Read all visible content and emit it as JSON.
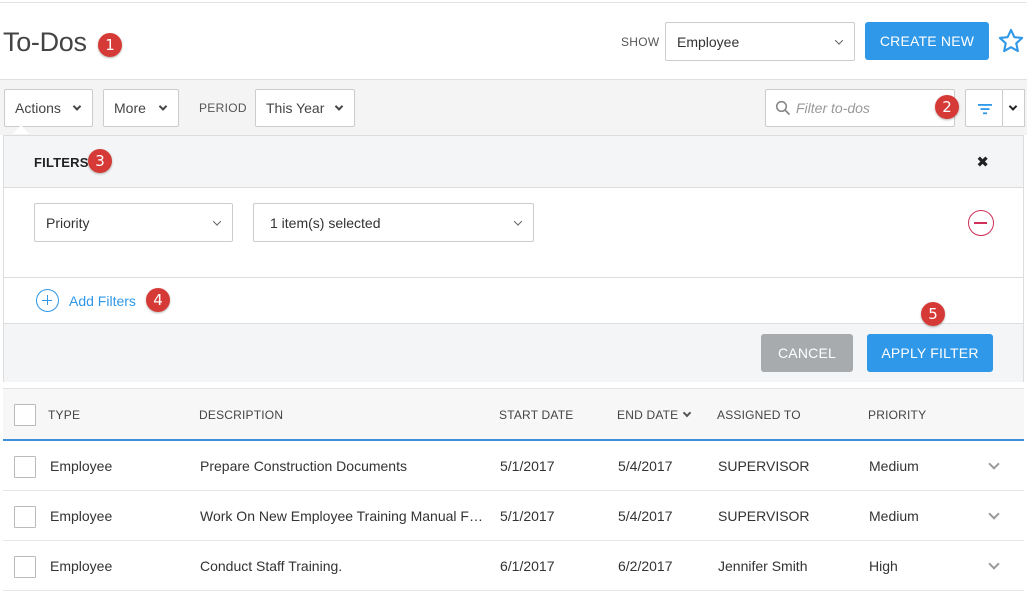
{
  "header": {
    "title": "To-Dos",
    "show_label": "SHOW",
    "show_value": "Employee",
    "create_button": "CREATE NEW"
  },
  "toolbar": {
    "actions_label": "Actions",
    "more_label": "More",
    "period_label": "PERIOD",
    "period_value": "This Year",
    "search_placeholder": "Filter to-dos"
  },
  "filters": {
    "title": "FILTERS",
    "field": "Priority",
    "value": "1 item(s) selected",
    "add_label": "Add Filters",
    "cancel_label": "CANCEL",
    "apply_label": "APPLY FILTER"
  },
  "annotations": [
    "1",
    "2",
    "3",
    "4",
    "5"
  ],
  "table": {
    "columns": [
      "TYPE",
      "DESCRIPTION",
      "START DATE",
      "END DATE",
      "ASSIGNED TO",
      "PRIORITY"
    ],
    "rows": [
      {
        "type": "Employee",
        "description": "Prepare Construction Documents",
        "start": "5/1/2017",
        "end": "5/4/2017",
        "assigned": "SUPERVISOR",
        "priority": "Medium"
      },
      {
        "type": "Employee",
        "description": "Work On New Employee Training Manual For Se",
        "start": "5/1/2017",
        "end": "5/4/2017",
        "assigned": "SUPERVISOR",
        "priority": "Medium"
      },
      {
        "type": "Employee",
        "description": "Conduct Staff Training.",
        "start": "6/1/2017",
        "end": "6/2/2017",
        "assigned": "Jennifer Smith",
        "priority": "High"
      }
    ]
  },
  "colors": {
    "primary": "#2f98e8",
    "badge": "#d63a36",
    "remove": "#d0305a",
    "cancel": "#a7abae"
  }
}
